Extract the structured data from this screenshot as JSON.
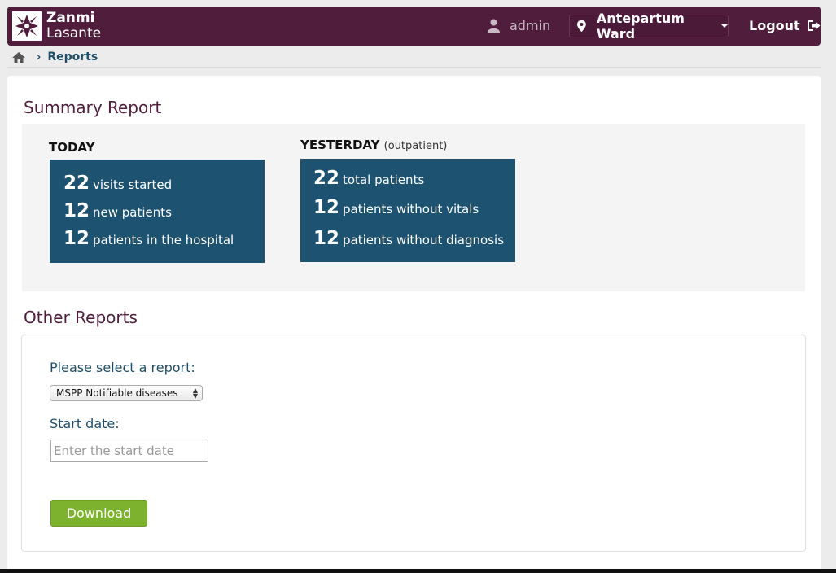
{
  "header": {
    "logo_line1": "Zanmi",
    "logo_line2": "Lasante",
    "user": "admin",
    "location": "Antepartum Ward",
    "logout": "Logout"
  },
  "breadcrumb": {
    "current": "Reports"
  },
  "summary": {
    "title": "Summary Report",
    "today": {
      "label": "TODAY",
      "rows": [
        {
          "num": "22",
          "label": "visits started"
        },
        {
          "num": "12",
          "label": "new patients"
        },
        {
          "num": "12",
          "label": "patients in the hospital"
        }
      ]
    },
    "yesterday": {
      "label": "YESTERDAY",
      "sub": "(outpatient)",
      "rows": [
        {
          "num": "22",
          "label": "total patients"
        },
        {
          "num": "12",
          "label": "patients without vitals"
        },
        {
          "num": "12",
          "label": "patients without diagnosis"
        }
      ]
    }
  },
  "other_reports": {
    "title": "Other Reports",
    "select_label": "Please select a report:",
    "select_value": "MSPP Notifiable diseases",
    "start_label": "Start date:",
    "start_placeholder": "Enter the start date",
    "download": "Download"
  },
  "colors": {
    "brand": "#501d3d",
    "card": "#1d5270",
    "button": "#7cb22e"
  }
}
